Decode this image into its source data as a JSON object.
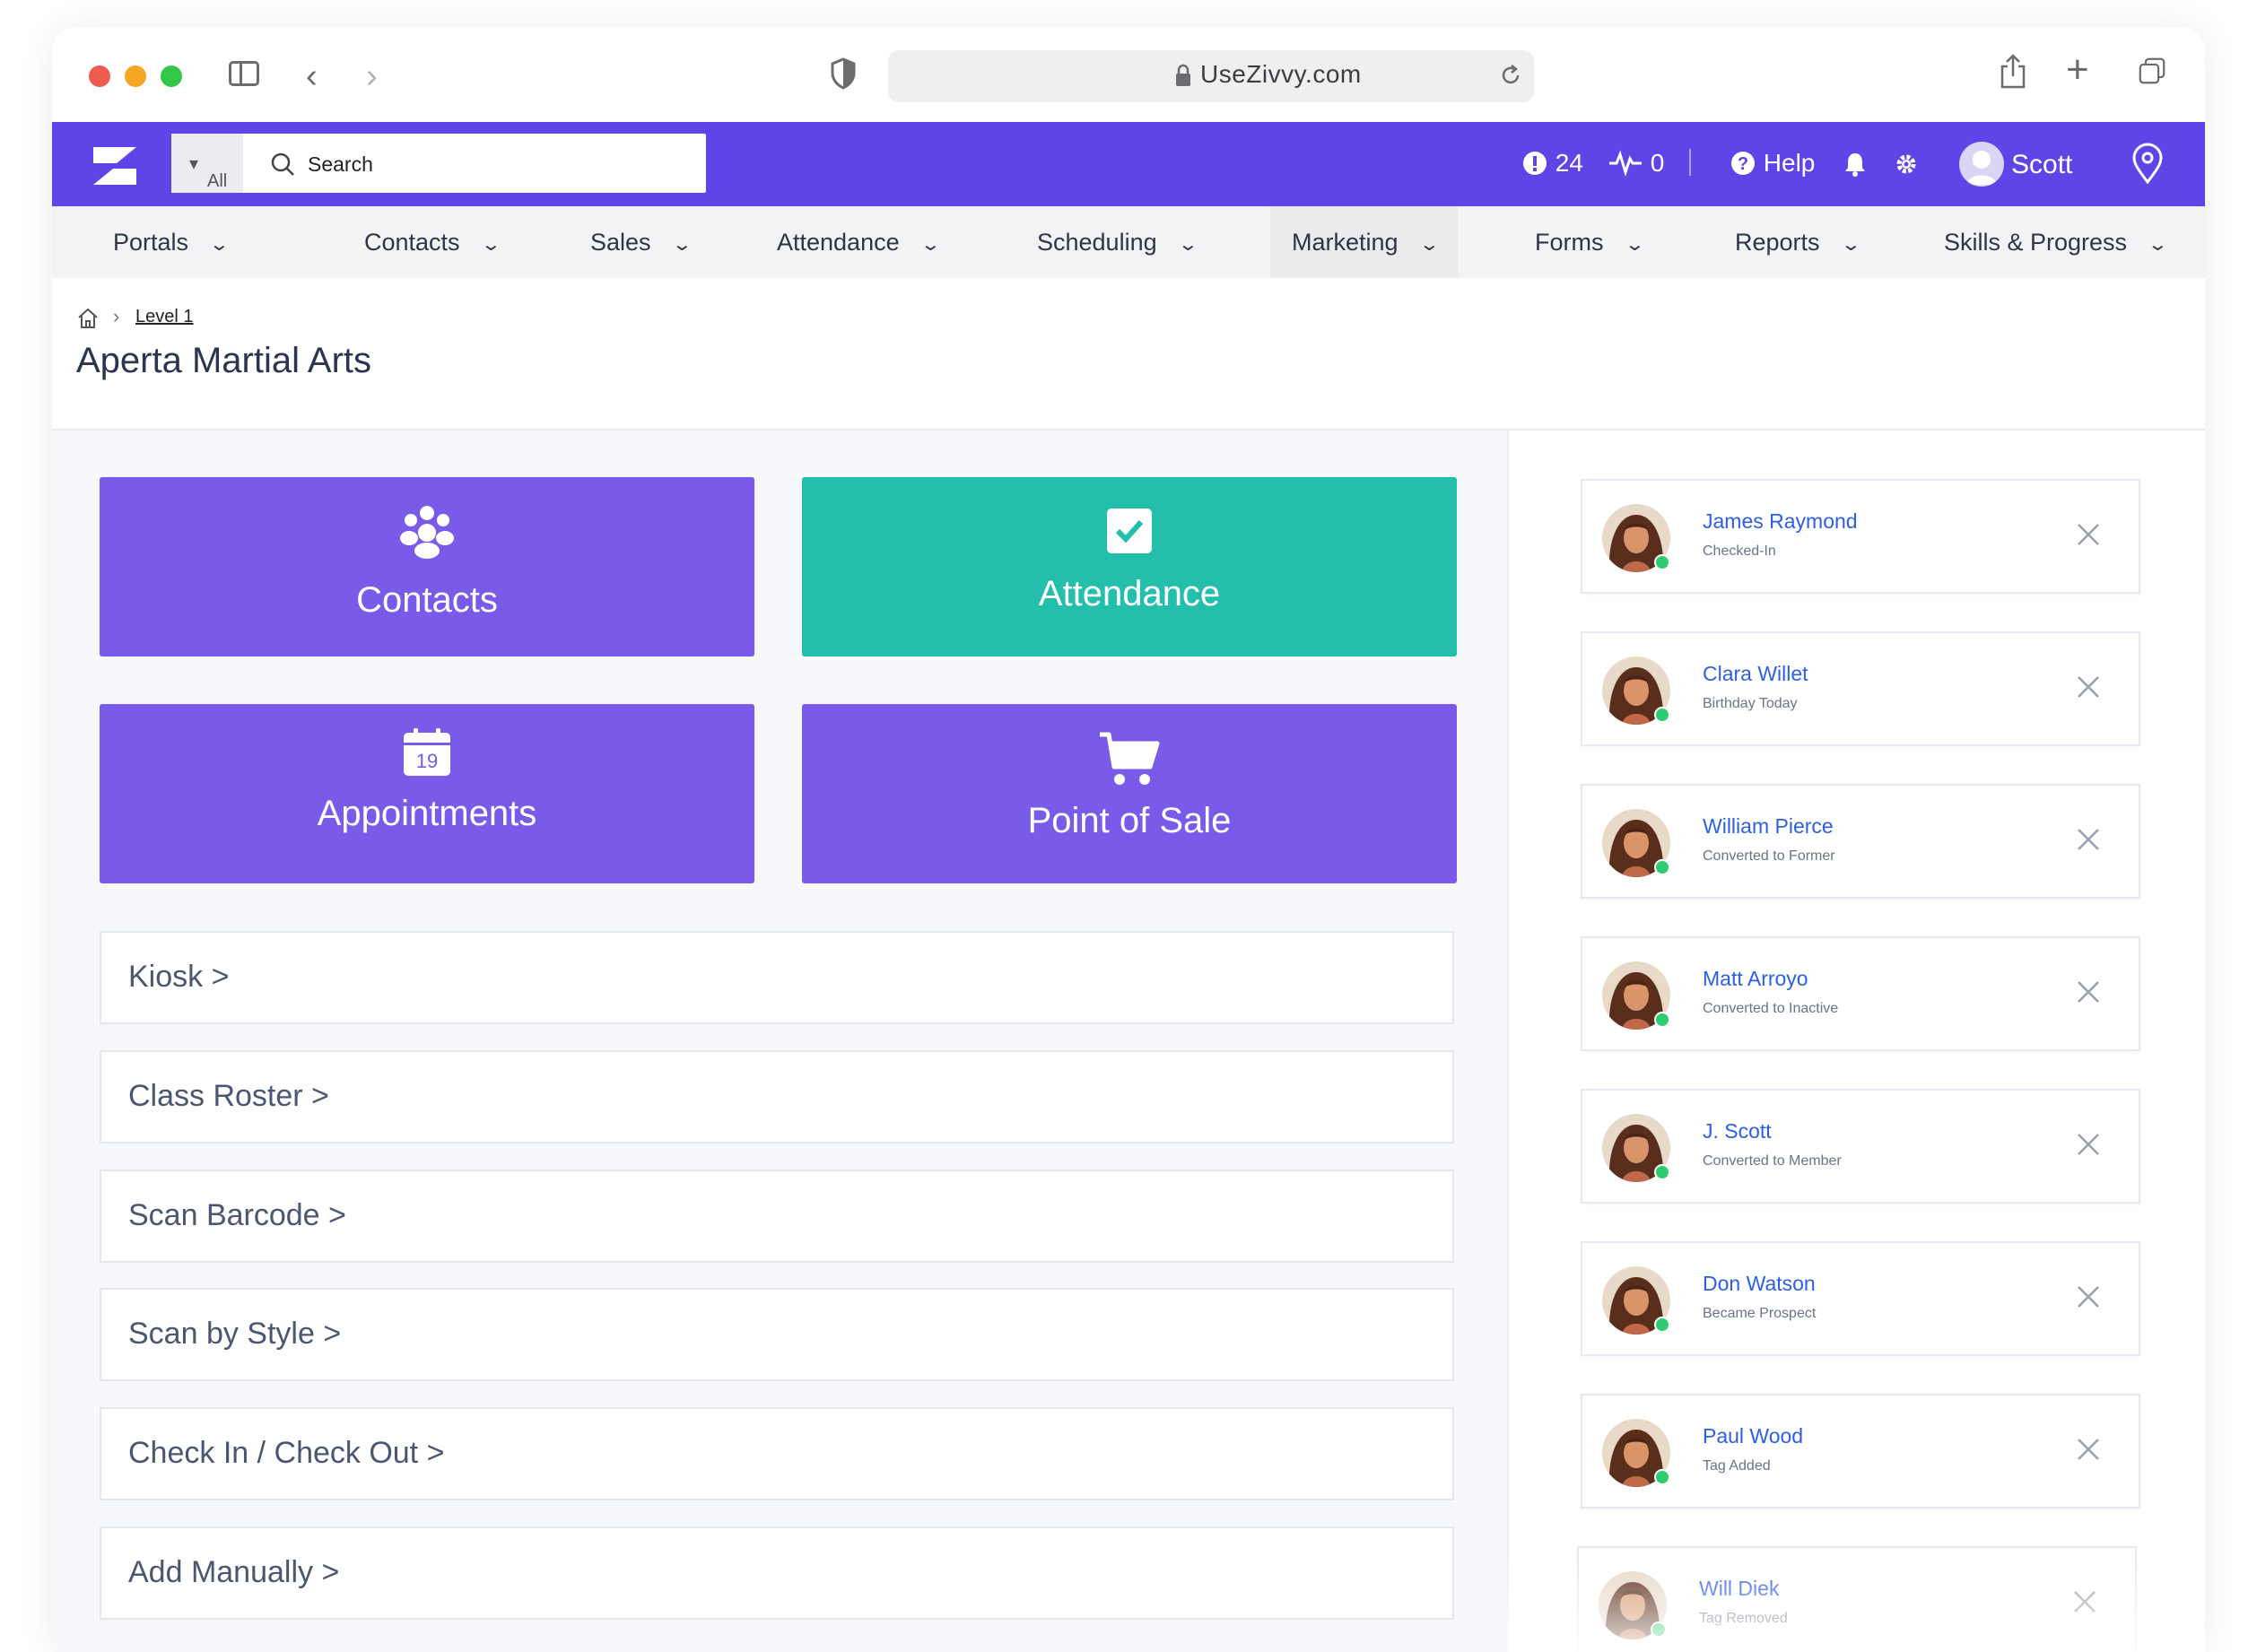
{
  "browser": {
    "url": "UseZivvy.com",
    "colors": {
      "close": "#ee5b4f",
      "minimize": "#f5a623",
      "zoom": "#33c748"
    }
  },
  "header": {
    "search_scope": "All",
    "search_placeholder": "Search",
    "alerts_count": "24",
    "activity_count": "0",
    "help_label": "Help",
    "user_name": "Scott",
    "brand_color": "#6044e8"
  },
  "nav": {
    "items": [
      {
        "label": "Portals"
      },
      {
        "label": "Contacts"
      },
      {
        "label": "Sales"
      },
      {
        "label": "Attendance"
      },
      {
        "label": "Scheduling"
      },
      {
        "label": "Marketing"
      },
      {
        "label": "Forms"
      },
      {
        "label": "Reports"
      },
      {
        "label": "Skills & Progress"
      }
    ]
  },
  "breadcrumb": {
    "level": "Level 1"
  },
  "page_title": "Aperta Martial Arts",
  "tiles": {
    "contacts": "Contacts",
    "attendance": "Attendance",
    "appointments": "Appointments",
    "appointments_day": "19",
    "pos": "Point of Sale"
  },
  "links": [
    {
      "label": "Kiosk >"
    },
    {
      "label": "Class Roster >"
    },
    {
      "label": "Scan Barcode >"
    },
    {
      "label": "Scan by Style >"
    },
    {
      "label": "Check In / Check Out >"
    },
    {
      "label": "Add Manually >"
    }
  ],
  "activity": [
    {
      "name": "James Raymond",
      "event": "Checked-In"
    },
    {
      "name": "Clara Willet",
      "event": "Birthday Today"
    },
    {
      "name": "William Pierce",
      "event": "Converted to Former"
    },
    {
      "name": "Matt Arroyo",
      "event": "Converted to Inactive"
    },
    {
      "name": "J. Scott",
      "event": "Converted to Member"
    },
    {
      "name": "Don Watson",
      "event": "Became Prospect"
    },
    {
      "name": "Paul Wood",
      "event": "Tag Added"
    },
    {
      "name": "Will Diek",
      "event": "Tag Removed"
    }
  ]
}
